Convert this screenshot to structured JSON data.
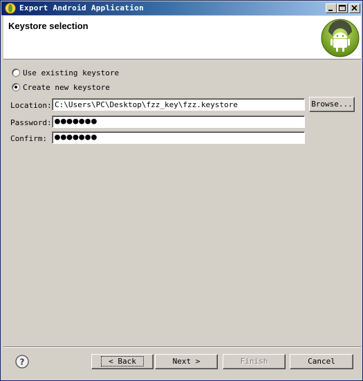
{
  "window": {
    "title": "Export Android Application",
    "controls": [
      "minimize-icon",
      "maximize-icon",
      "close-icon"
    ]
  },
  "header": {
    "title": "Keystore selection",
    "logo_icon": "android-icon"
  },
  "options": {
    "use_existing_label": "Use existing keystore",
    "create_new_label": "Create new keystore",
    "selected": "create_new"
  },
  "form": {
    "location_label": "Location:",
    "location_value": "C:\\Users\\PC\\Desktop\\fzz_key\\fzz.keystore",
    "browse_label": "Browse...",
    "password_label": "Password:",
    "password_value": "●●●●●●●",
    "confirm_label": "Confirm:",
    "confirm_value": "●●●●●●●"
  },
  "footer": {
    "help_icon": "help-icon",
    "back_label": "< Back",
    "next_label": "Next >",
    "finish_label": "Finish",
    "cancel_label": "Cancel"
  },
  "colors": {
    "titlebar_start": "#0a246a",
    "titlebar_end": "#a6caf0",
    "face": "#d4d0c8",
    "android_green": "#a4c639"
  }
}
